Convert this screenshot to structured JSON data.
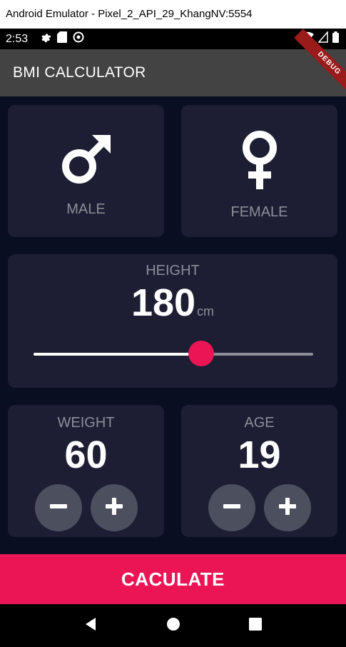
{
  "window": {
    "title": "Android Emulator - Pixel_2_API_29_KhangNV:5554"
  },
  "status_bar": {
    "time": "2:53"
  },
  "app_bar": {
    "title": "BMI CALCULATOR"
  },
  "debug_banner": "DEBUG",
  "gender": {
    "male_label": "MALE",
    "female_label": "FEMALE"
  },
  "height": {
    "label": "HEIGHT",
    "value": "180",
    "unit": "cm",
    "slider_fraction": 0.6
  },
  "weight": {
    "label": "WEIGHT",
    "value": "60"
  },
  "age": {
    "label": "AGE",
    "value": "19"
  },
  "calculate": {
    "label": "CACULATE"
  },
  "colors": {
    "background": "#0a0e21",
    "card": "#1d1e33",
    "accent": "#eb1555",
    "button": "#4c4f5e",
    "label": "#8d8e98"
  }
}
